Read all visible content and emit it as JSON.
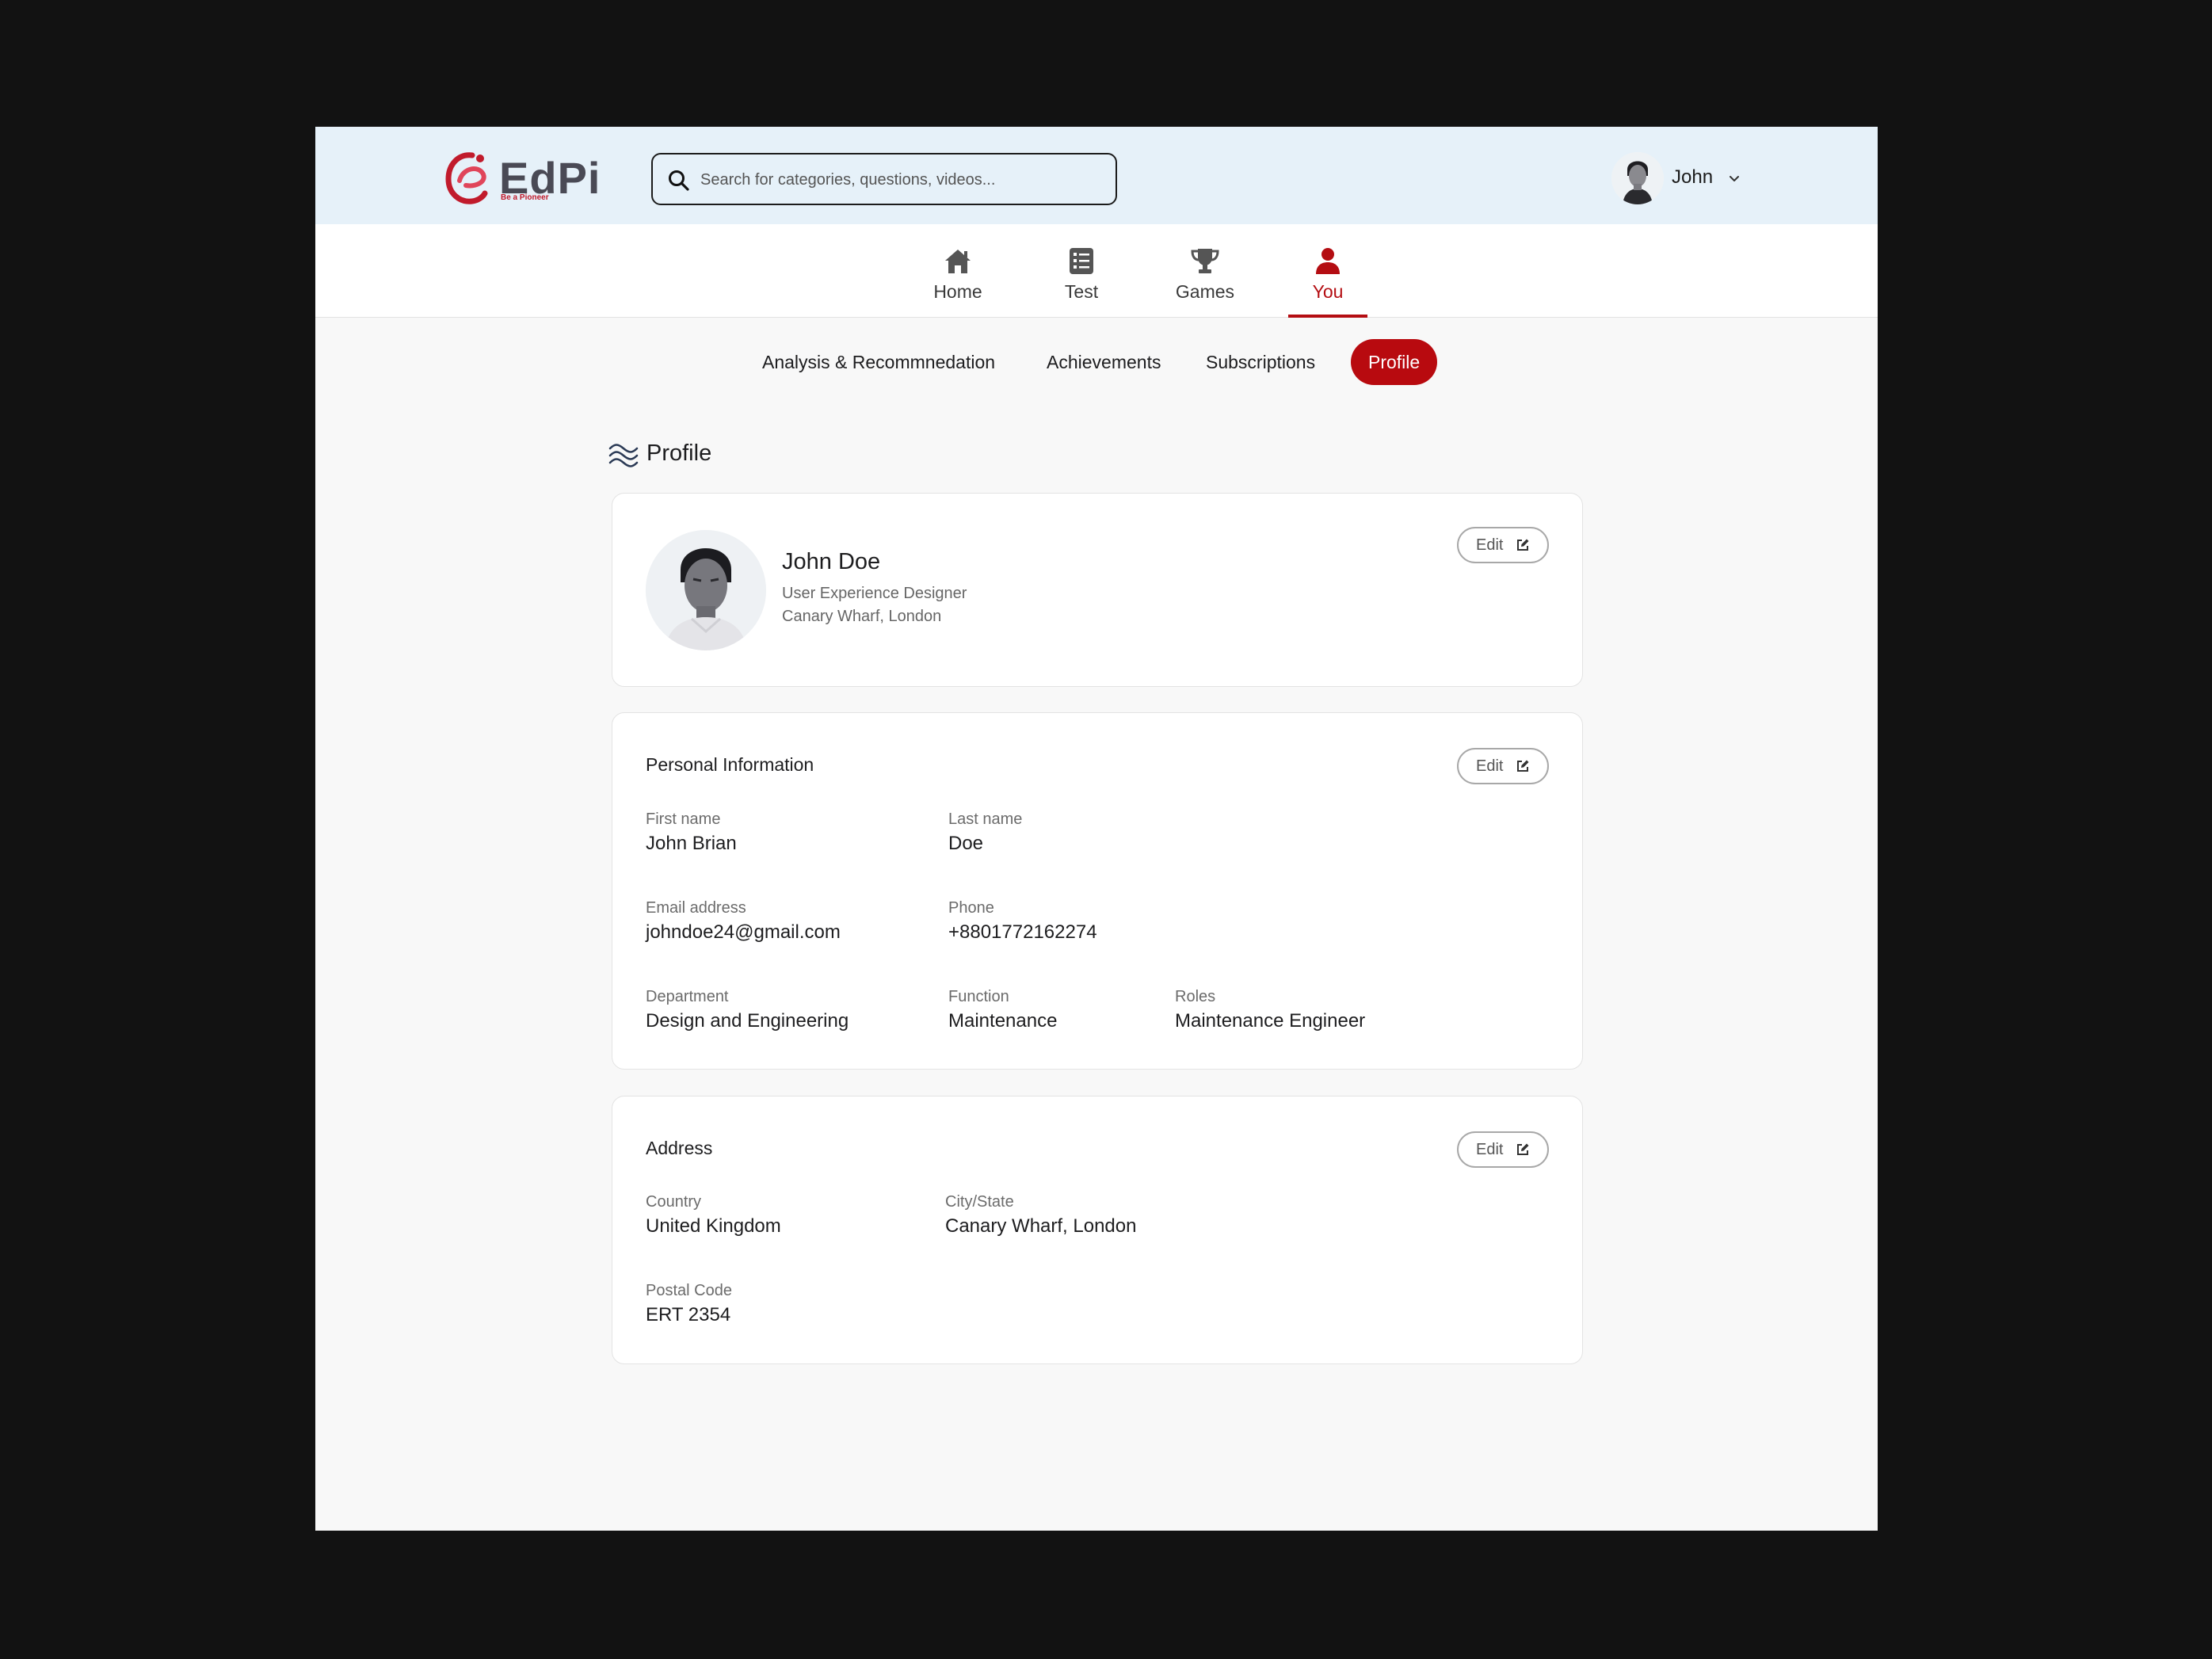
{
  "brand": {
    "name_ed": "Ed",
    "name_pi": "Pi",
    "tagline": "Be a Pioneer",
    "accent_color": "#b80a0f"
  },
  "search": {
    "placeholder": "Search for categories, questions, videos...",
    "icon": "search-icon"
  },
  "user_menu": {
    "name": "John",
    "icon": "chevron-down-icon"
  },
  "main_nav": [
    {
      "label": "Home",
      "icon": "home-icon",
      "active": false
    },
    {
      "label": "Test",
      "icon": "checklist-icon",
      "active": false
    },
    {
      "label": "Games",
      "icon": "trophy-icon",
      "active": false
    },
    {
      "label": "You",
      "icon": "user-icon",
      "active": true
    }
  ],
  "sub_tabs": [
    {
      "label": "Analysis & Recommnedation",
      "active": false
    },
    {
      "label": "Achievements",
      "active": false
    },
    {
      "label": "Subscriptions",
      "active": false
    },
    {
      "label": "Profile",
      "active": true
    }
  ],
  "page": {
    "title": "Profile",
    "title_icon": "waves-icon"
  },
  "profile_card": {
    "name": "John Doe",
    "role": "User Experience Designer",
    "location": "Canary Wharf, London",
    "edit_label": "Edit"
  },
  "personal_info": {
    "title": "Personal Information",
    "edit_label": "Edit",
    "first_name_label": "First name",
    "first_name": "John Brian",
    "last_name_label": "Last name",
    "last_name": "Doe",
    "email_label": "Email address",
    "email": "johndoe24@gmail.com",
    "phone_label": "Phone",
    "phone": "+8801772162274",
    "department_label": "Department",
    "department": "Design and Engineering",
    "function_label": "Function",
    "function": "Maintenance",
    "roles_label": "Roles",
    "roles": "Maintenance Engineer"
  },
  "address": {
    "title": "Address",
    "edit_label": "Edit",
    "country_label": "Country",
    "country": "United Kingdom",
    "city_label": "City/State",
    "city": "Canary Wharf, London",
    "postal_label": "Postal Code",
    "postal": "ERT 2354"
  }
}
